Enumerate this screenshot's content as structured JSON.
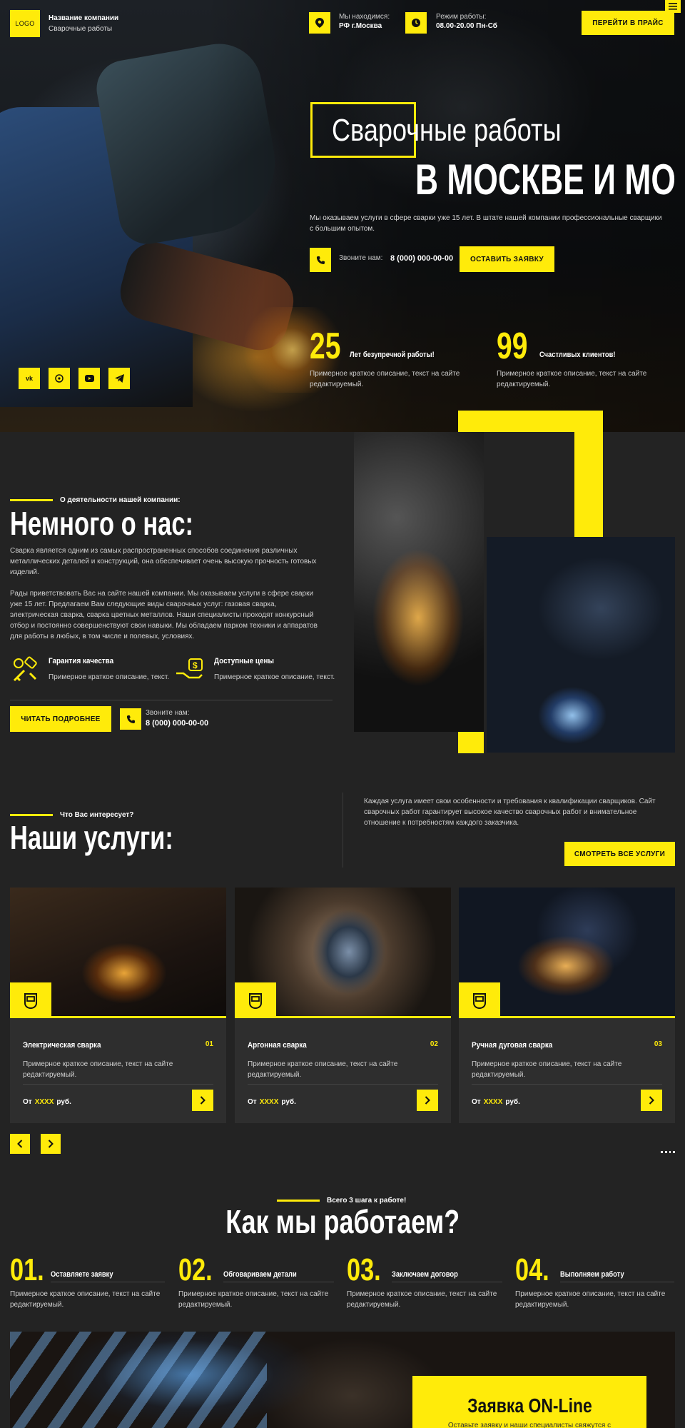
{
  "header": {
    "logo": "LOGO",
    "company_name": "Название компании",
    "company_sub": "Сварочные работы",
    "location_label": "Мы находимся:",
    "location_value": "РФ г.Москва",
    "hours_label": "Режим работы:",
    "hours_value": "08.00-20.00 Пн-Сб",
    "price_button": "ПЕРЕЙТИ В ПРАЙС"
  },
  "hero": {
    "title_line1": "Сварочные работы",
    "title_line2": "В МОСКВЕ И МО",
    "description": "Мы оказываем услуги в сфере сварки уже 15 лет. В штате нашей компании профессиональные сварщики с большим опытом.",
    "call_label": "Звоните нам:",
    "phone": "8 (000) 000-00-00",
    "apply_button": "ОСТАВИТЬ ЗАЯВКУ",
    "stats": [
      {
        "number": "25",
        "label": "Лет безупречной работы!",
        "desc": "Примерное краткое описание, текст на сайте редактируемый."
      },
      {
        "number": "99",
        "label": "Счастливых клиентов!",
        "desc": "Примерное краткое описание, текст на сайте редактируемый."
      }
    ],
    "social_icons": [
      "vk-icon",
      "whatsapp-icon",
      "youtube-icon",
      "telegram-icon"
    ]
  },
  "about": {
    "kicker": "О деятельности нашей компании:",
    "title": "Немного о нас:",
    "para1": "Сварка является одним из самых распространенных способов соединения различных металлических деталей и конструкций, она обеспечивает очень высокую прочность готовых изделий.",
    "para2": "Рады приветствовать Вас на сайте нашей компании. Мы оказываем услуги в сфере сварки уже 15 лет. Предлагаем Вам следующие виды сварочных услуг: газовая сварка, электрическая сварка, сварка цветных металлов. Наши специалисты проходят конкурсный отбор и постоянно совершенствуют свои навыки. Мы обладаем парком техники и аппаратов для работы в любых, в том числе и полевых, условиях.",
    "features": [
      {
        "title": "Гарантия качества",
        "desc": "Примерное краткое описание, текст."
      },
      {
        "title": "Доступные цены",
        "desc": "Примерное краткое описание, текст."
      }
    ],
    "read_more": "ЧИТАТЬ ПОДРОБНЕЕ",
    "call_label": "Звоните нам:",
    "phone": "8 (000) 000-00-00"
  },
  "services": {
    "kicker": "Что Вас интересует?",
    "title": "Наши услуги:",
    "intro": "Каждая услуга имеет свои особенности и требования к квалификации сварщиков. Сайт сварочных работ гарантирует высокое качество сварочных работ и внимательное отношение к потребностям каждого заказчика.",
    "all_button": "СМОТРЕТЬ ВСЕ УСЛУГИ",
    "items": [
      {
        "title": "Электрическая сварка",
        "num": "01",
        "desc": "Примерное краткое описание, текст на сайте редактируемый.",
        "price_prefix": "От",
        "price": "XXXX",
        "price_suffix": "руб."
      },
      {
        "title": "Аргонная сварка",
        "num": "02",
        "desc": "Примерное краткое описание, текст на сайте редактируемый.",
        "price_prefix": "От",
        "price": "XXXX",
        "price_suffix": "руб."
      },
      {
        "title": "Ручная дуговая сварка",
        "num": "03",
        "desc": "Примерное краткое описание, текст на сайте редактируемый.",
        "price_prefix": "От",
        "price": "XXXX",
        "price_suffix": "руб."
      }
    ]
  },
  "steps": {
    "kicker": "Всего 3 шага к работе!",
    "title": "Как мы работаем?",
    "items": [
      {
        "num": "01.",
        "title": "Оставляете заявку",
        "desc": "Примерное краткое описание, текст на сайте редактируемый."
      },
      {
        "num": "02.",
        "title": "Обговариваем детали",
        "desc": "Примерное краткое описание, текст на сайте редактируемый."
      },
      {
        "num": "03.",
        "title": "Заключаем договор",
        "desc": "Примерное краткое описание, текст на сайте редактируемый."
      },
      {
        "num": "04.",
        "title": "Выполняем работу",
        "desc": "Примерное краткое описание, текст на сайте редактируемый."
      }
    ]
  },
  "form": {
    "title": "Заявка ON-Line",
    "subtitle": "Оставьте заявку и наши специалисты свяжутся с"
  },
  "colors": {
    "accent": "#ffeb0a",
    "background": "#232323",
    "card": "#2e2e2e"
  }
}
